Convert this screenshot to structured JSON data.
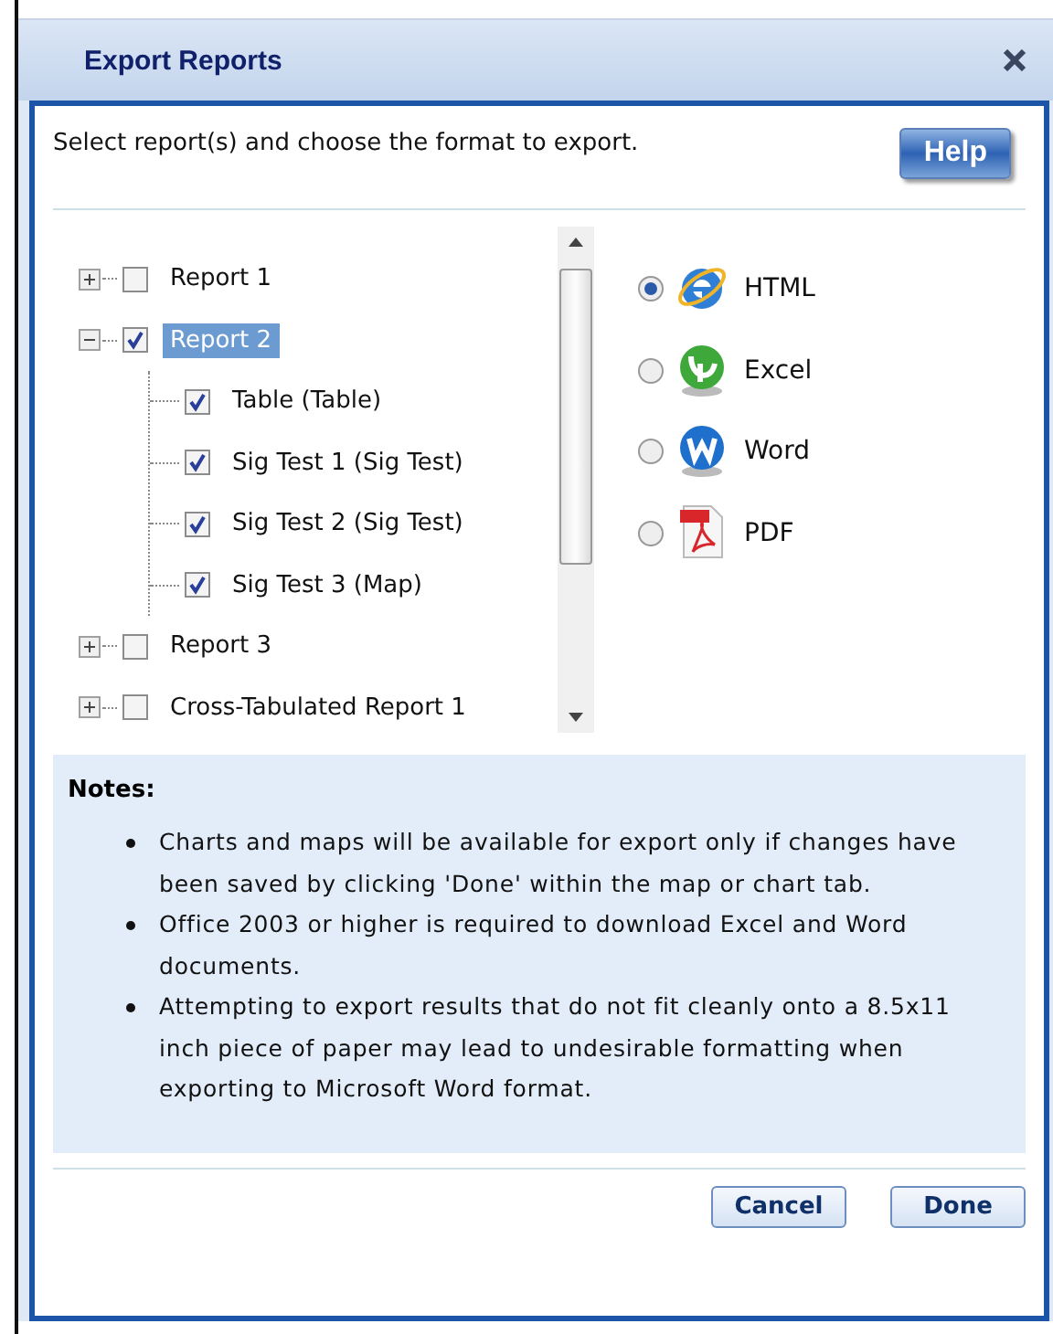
{
  "window": {
    "title": "Export Reports"
  },
  "instructions": "Select report(s) and choose the format to export.",
  "help_button": "Help",
  "tree": [
    {
      "label": "Report 1",
      "checked": false,
      "expanded": false,
      "selected": false
    },
    {
      "label": "Report 2",
      "checked": true,
      "expanded": true,
      "selected": true,
      "children": [
        {
          "label": "Table (Table)",
          "checked": true,
          "selected": false
        },
        {
          "label": "Sig Test 1 (Sig Test)",
          "checked": true,
          "selected": false
        },
        {
          "label": "Sig Test 2 (Sig Test)",
          "checked": true,
          "selected": false
        },
        {
          "label": "Sig Test 3 (Map)",
          "checked": true,
          "selected": false
        }
      ]
    },
    {
      "label": "Report 3",
      "checked": false,
      "expanded": false,
      "selected": false
    },
    {
      "label": "Cross-Tabulated Report 1",
      "checked": false,
      "expanded": false,
      "selected": false
    }
  ],
  "formats": [
    {
      "label": "HTML",
      "kind": "html",
      "selected": true
    },
    {
      "label": "Excel",
      "kind": "excel",
      "selected": false
    },
    {
      "label": "Word",
      "kind": "word",
      "selected": false
    },
    {
      "label": "PDF",
      "kind": "pdf",
      "selected": false
    }
  ],
  "notes": {
    "title": "Notes:",
    "items": [
      "Charts and maps will be available for export only if changes have been saved by clicking 'Done' within the map or chart tab.",
      "Office 2003 or higher is required to download Excel and Word documents.",
      "Attempting to export results that do not fit cleanly onto a 8.5x11 inch piece of paper may lead to undesirable formatting when exporting to Microsoft Word format."
    ]
  },
  "buttons": [
    "Cancel",
    "Done"
  ]
}
